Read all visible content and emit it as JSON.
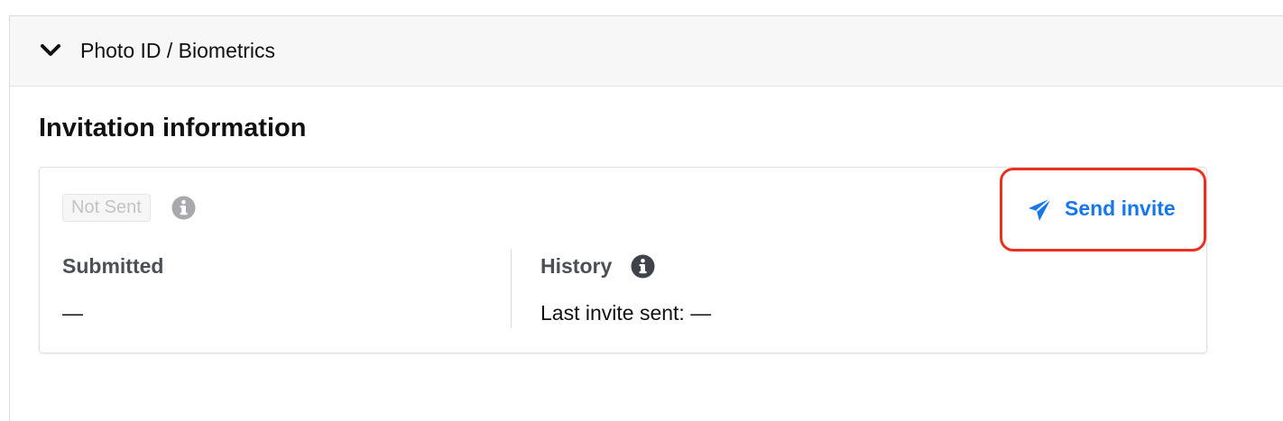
{
  "panel": {
    "title": "Photo ID / Biometrics",
    "chevron_icon": "chevron-down-icon"
  },
  "section": {
    "title": "Invitation information"
  },
  "invitation": {
    "status": "Not Sent",
    "status_info_icon": "info-icon",
    "send_button_label": "Send invite",
    "send_icon": "paper-plane-icon",
    "submitted_label": "Submitted",
    "submitted_value": "—",
    "history_label": "History",
    "history_info_icon": "info-icon",
    "last_invite_text": "Last invite sent: —"
  },
  "colors": {
    "accent": "#1677e8",
    "highlight_outline": "#e8321f",
    "muted_badge_text": "#c4c4c4",
    "label_text": "#4b4f56"
  }
}
